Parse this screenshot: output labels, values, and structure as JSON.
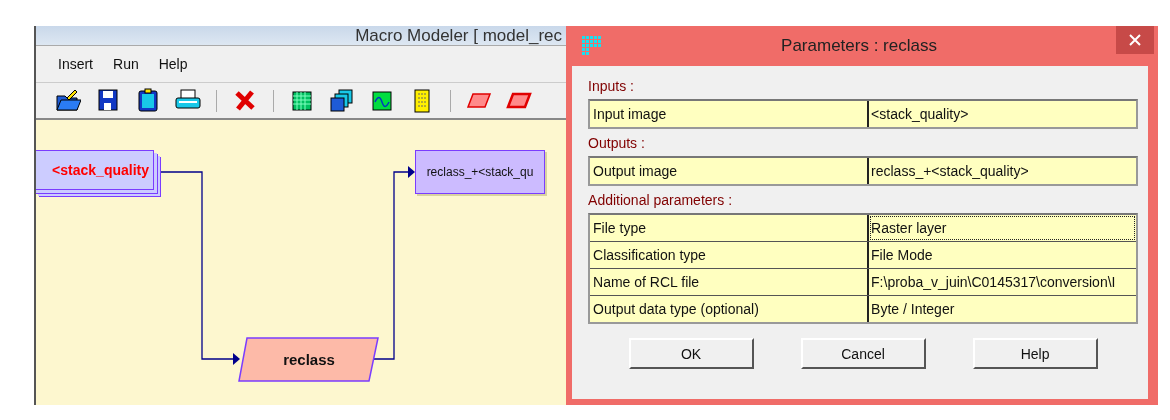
{
  "main_window": {
    "title": "Macro Modeler  [ model_rec",
    "menu": [
      "Insert",
      "Run",
      "Help"
    ],
    "diagram": {
      "nodes": [
        {
          "kind": "input",
          "label": "<stack_quality"
        },
        {
          "kind": "process",
          "label": "reclass"
        },
        {
          "kind": "output",
          "label": "reclass_+<stack_qu"
        }
      ]
    }
  },
  "dialog": {
    "title": "Parameters : reclass",
    "sections": [
      {
        "heading": "Inputs :",
        "rows": [
          {
            "name": "Input image",
            "value": "<stack_quality>",
            "focused": false
          }
        ]
      },
      {
        "heading": "Outputs :",
        "rows": [
          {
            "name": "Output image",
            "value": "reclass_+<stack_quality>",
            "focused": false
          }
        ]
      },
      {
        "heading": "Additional parameters :",
        "rows": [
          {
            "name": "File type",
            "value": "Raster layer",
            "focused": true
          },
          {
            "name": "Classification type",
            "value": "File Mode",
            "focused": false
          },
          {
            "name": "Name of RCL file",
            "value": "F:\\proba_v_juin\\C0145317\\conversion\\I",
            "focused": false
          },
          {
            "name": "Output data type (optional)",
            "value": "Byte / Integer",
            "focused": false
          }
        ]
      }
    ],
    "buttons": [
      "OK",
      "Cancel",
      "Help"
    ]
  }
}
